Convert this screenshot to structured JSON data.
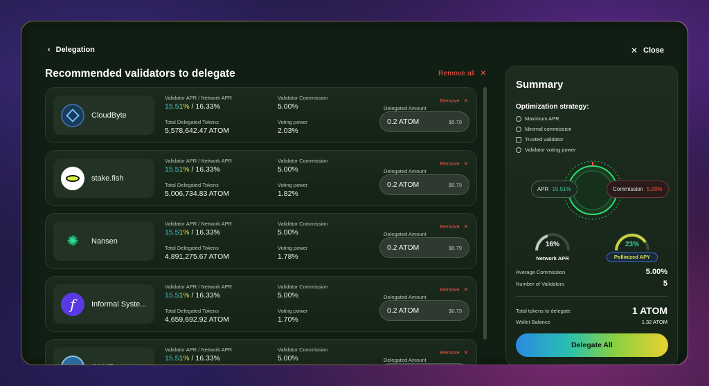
{
  "header": {
    "back_label": "Delegation",
    "close_label": "Close"
  },
  "list": {
    "title": "Recommended validators to delegate",
    "remove_all": "Remove all",
    "field_labels": {
      "apr": "Validator APR / Network APR",
      "commission": "Validator Commission",
      "tokens": "Total Delegated Tokens",
      "voting": "Voting power",
      "amount": "Delegated Amount",
      "remove": "Remove"
    },
    "validators": [
      {
        "name": "CloudByte",
        "apr_a": "15.5",
        "apr_b": "1%",
        "network_apr": " / 16.33%",
        "commission": "5.00%",
        "tokens": "5,578,642.47 ATOM",
        "voting": "2.03%",
        "amount": "0.2 ATOM",
        "usd": "$0.79",
        "icon": "cloudbyte-logo"
      },
      {
        "name": "stake.fish",
        "apr_a": "15.5",
        "apr_b": "1%",
        "network_apr": " / 16.33%",
        "commission": "5.00%",
        "tokens": "5,006,734.83 ATOM",
        "voting": "1.82%",
        "amount": "0.2 ATOM",
        "usd": "$0.79",
        "icon": "stakefish-logo"
      },
      {
        "name": "Nansen",
        "apr_a": "15.5",
        "apr_b": "1%",
        "network_apr": " / 16.33%",
        "commission": "5.00%",
        "tokens": "4,891,275.67 ATOM",
        "voting": "1.78%",
        "amount": "0.2 ATOM",
        "usd": "$0.79",
        "icon": "nansen-logo"
      },
      {
        "name": "Informal Syste...",
        "apr_a": "15.5",
        "apr_b": "1%",
        "network_apr": " / 16.33%",
        "commission": "5.00%",
        "tokens": "4,659,692.92 ATOM",
        "voting": "1.70%",
        "amount": "0.2 ATOM",
        "usd": "$0.79",
        "icon": "informal-systems-logo"
      },
      {
        "name": "CAME",
        "apr_a": "15.5",
        "apr_b": "1%",
        "network_apr": " / 16.33%",
        "commission": "5.00%",
        "tokens": "",
        "voting": "",
        "amount": "",
        "usd": "",
        "icon": "validator-logo"
      }
    ]
  },
  "summary": {
    "title": "Summary",
    "strategy_label": "Optimization strategy:",
    "strategies": [
      "Maximum APR",
      "Minimal commission",
      "Trusted validator",
      "Validator voting power"
    ],
    "apr_pill_label": "APR",
    "apr_pill_value": "15.51%",
    "commission_pill_label": "Commission",
    "commission_pill_value": "5.00%",
    "network_apr_value": "16%",
    "network_apr_label": "Network APR",
    "pollinized_value": "23%",
    "pollinized_label": "Pollinized APY",
    "avg_commission_label": "Average Commission",
    "avg_commission_value": "5.00%",
    "num_validators_label": "Number of Validators",
    "num_validators_value": "5",
    "total_tokens_label": "Total tokens to delegate",
    "total_tokens_value": "1 ATOM",
    "wallet_label": "Wallet Balance",
    "wallet_value": "1.32 ATOM",
    "delegate_button": "Delegate All",
    "colors": {
      "apr": "#3ec4a0",
      "commission": "#ff5a4a",
      "accent": "#2adf70"
    }
  }
}
